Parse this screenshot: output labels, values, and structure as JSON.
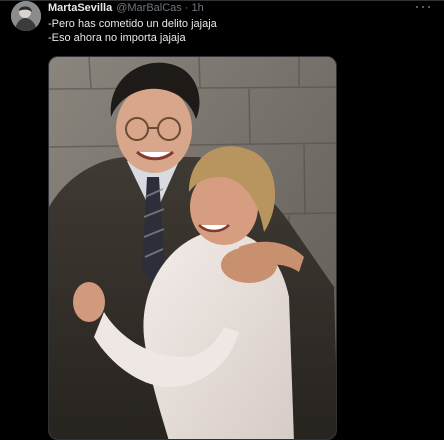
{
  "tweet": {
    "author": {
      "display_name": "MartaSevilla",
      "handle": "@MarBalCas",
      "separator": "·",
      "time": "1h"
    },
    "lines": [
      "-Pero has cometido un delito jajaja",
      "-Eso ahora no importa jajaja"
    ],
    "icons": {
      "avatar": "avatar",
      "more": "more-options-icon"
    }
  },
  "colors": {
    "background": "#000000",
    "primary_text": "#e7e9ea",
    "secondary_text": "#71767b",
    "border": "#2f3336"
  }
}
